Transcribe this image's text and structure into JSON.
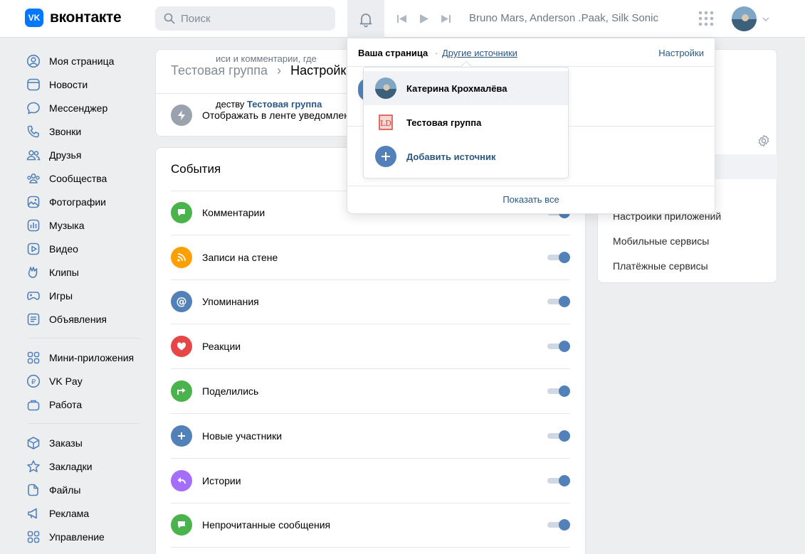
{
  "header": {
    "logo_mark": "VK",
    "logo_text": "вконтакте",
    "search_placeholder": "Поиск",
    "track": "Bruno Mars, Anderson .Paak, Silk Sonic",
    "accent": "#0077ff"
  },
  "sidebar": {
    "group1": [
      {
        "label": "Моя страница",
        "icon": "user-circle-icon"
      },
      {
        "label": "Новости",
        "icon": "news-icon"
      },
      {
        "label": "Мессенджер",
        "icon": "message-icon"
      },
      {
        "label": "Звонки",
        "icon": "phone-icon"
      },
      {
        "label": "Друзья",
        "icon": "friends-icon"
      },
      {
        "label": "Сообщества",
        "icon": "communities-icon"
      },
      {
        "label": "Фотографии",
        "icon": "photo-icon"
      },
      {
        "label": "Музыка",
        "icon": "music-icon"
      },
      {
        "label": "Видео",
        "icon": "video-icon"
      },
      {
        "label": "Клипы",
        "icon": "clips-icon"
      },
      {
        "label": "Игры",
        "icon": "games-icon"
      },
      {
        "label": "Объявления",
        "icon": "ads-board-icon"
      }
    ],
    "group2": [
      {
        "label": "Мини-приложения",
        "icon": "mini-apps-icon"
      },
      {
        "label": "VK Pay",
        "icon": "vk-pay-icon"
      },
      {
        "label": "Работа",
        "icon": "work-icon"
      }
    ],
    "group3": [
      {
        "label": "Заказы",
        "icon": "orders-icon"
      },
      {
        "label": "Закладки",
        "icon": "bookmark-icon"
      },
      {
        "label": "Файлы",
        "icon": "files-icon"
      },
      {
        "label": "Реклама",
        "icon": "advertising-icon"
      },
      {
        "label": "Управление",
        "icon": "manage-icon"
      }
    ]
  },
  "main": {
    "breadcrumb_parent": "Тестовая группа",
    "breadcrumb_current": "Настройки",
    "notif_row_label": "Отображать в ленте уведомлений",
    "events_title": "События",
    "events": [
      {
        "label": "Комментарии",
        "color": "#4bb34b",
        "icon": "comment-icon",
        "enabled": true
      },
      {
        "label": "Записи на стене",
        "color": "#ffa000",
        "icon": "rss-icon",
        "enabled": true
      },
      {
        "label": "Упоминания",
        "color": "#5181b8",
        "icon": "mention-icon",
        "enabled": true
      },
      {
        "label": "Реакции",
        "color": "#e64646",
        "icon": "heart-icon",
        "enabled": true
      },
      {
        "label": "Поделились",
        "color": "#4bb34b",
        "icon": "share-icon",
        "enabled": true
      },
      {
        "label": "Новые участники",
        "color": "#5181b8",
        "icon": "plus-icon",
        "enabled": true
      },
      {
        "label": "Истории",
        "color": "#a56efa",
        "icon": "reply-icon",
        "enabled": true
      },
      {
        "label": "Непрочитанные сообщения",
        "color": "#4bb34b",
        "icon": "message-icon",
        "enabled": true
      }
    ]
  },
  "right_menu": {
    "links": [
      "Настройки приложений",
      "Мобильные сервисы",
      "Платёжные сервисы"
    ]
  },
  "popup": {
    "your_page": "Ваша страница",
    "dot": "·",
    "other_sources": "Другие источники",
    "settings": "Настройки",
    "hidden_text_1": "иси и комментарии, где",
    "hidden_text_2": "деству",
    "hidden_group": "Тестовая группа",
    "show_all": "Показать все",
    "dropdown": [
      {
        "label": "Катерина Крохмалёва",
        "type": "avatar",
        "selected": true
      },
      {
        "label": "Тестовая группа",
        "type": "group-logo",
        "selected": false
      },
      {
        "label": "Добавить источник",
        "type": "add",
        "selected": false
      }
    ]
  }
}
